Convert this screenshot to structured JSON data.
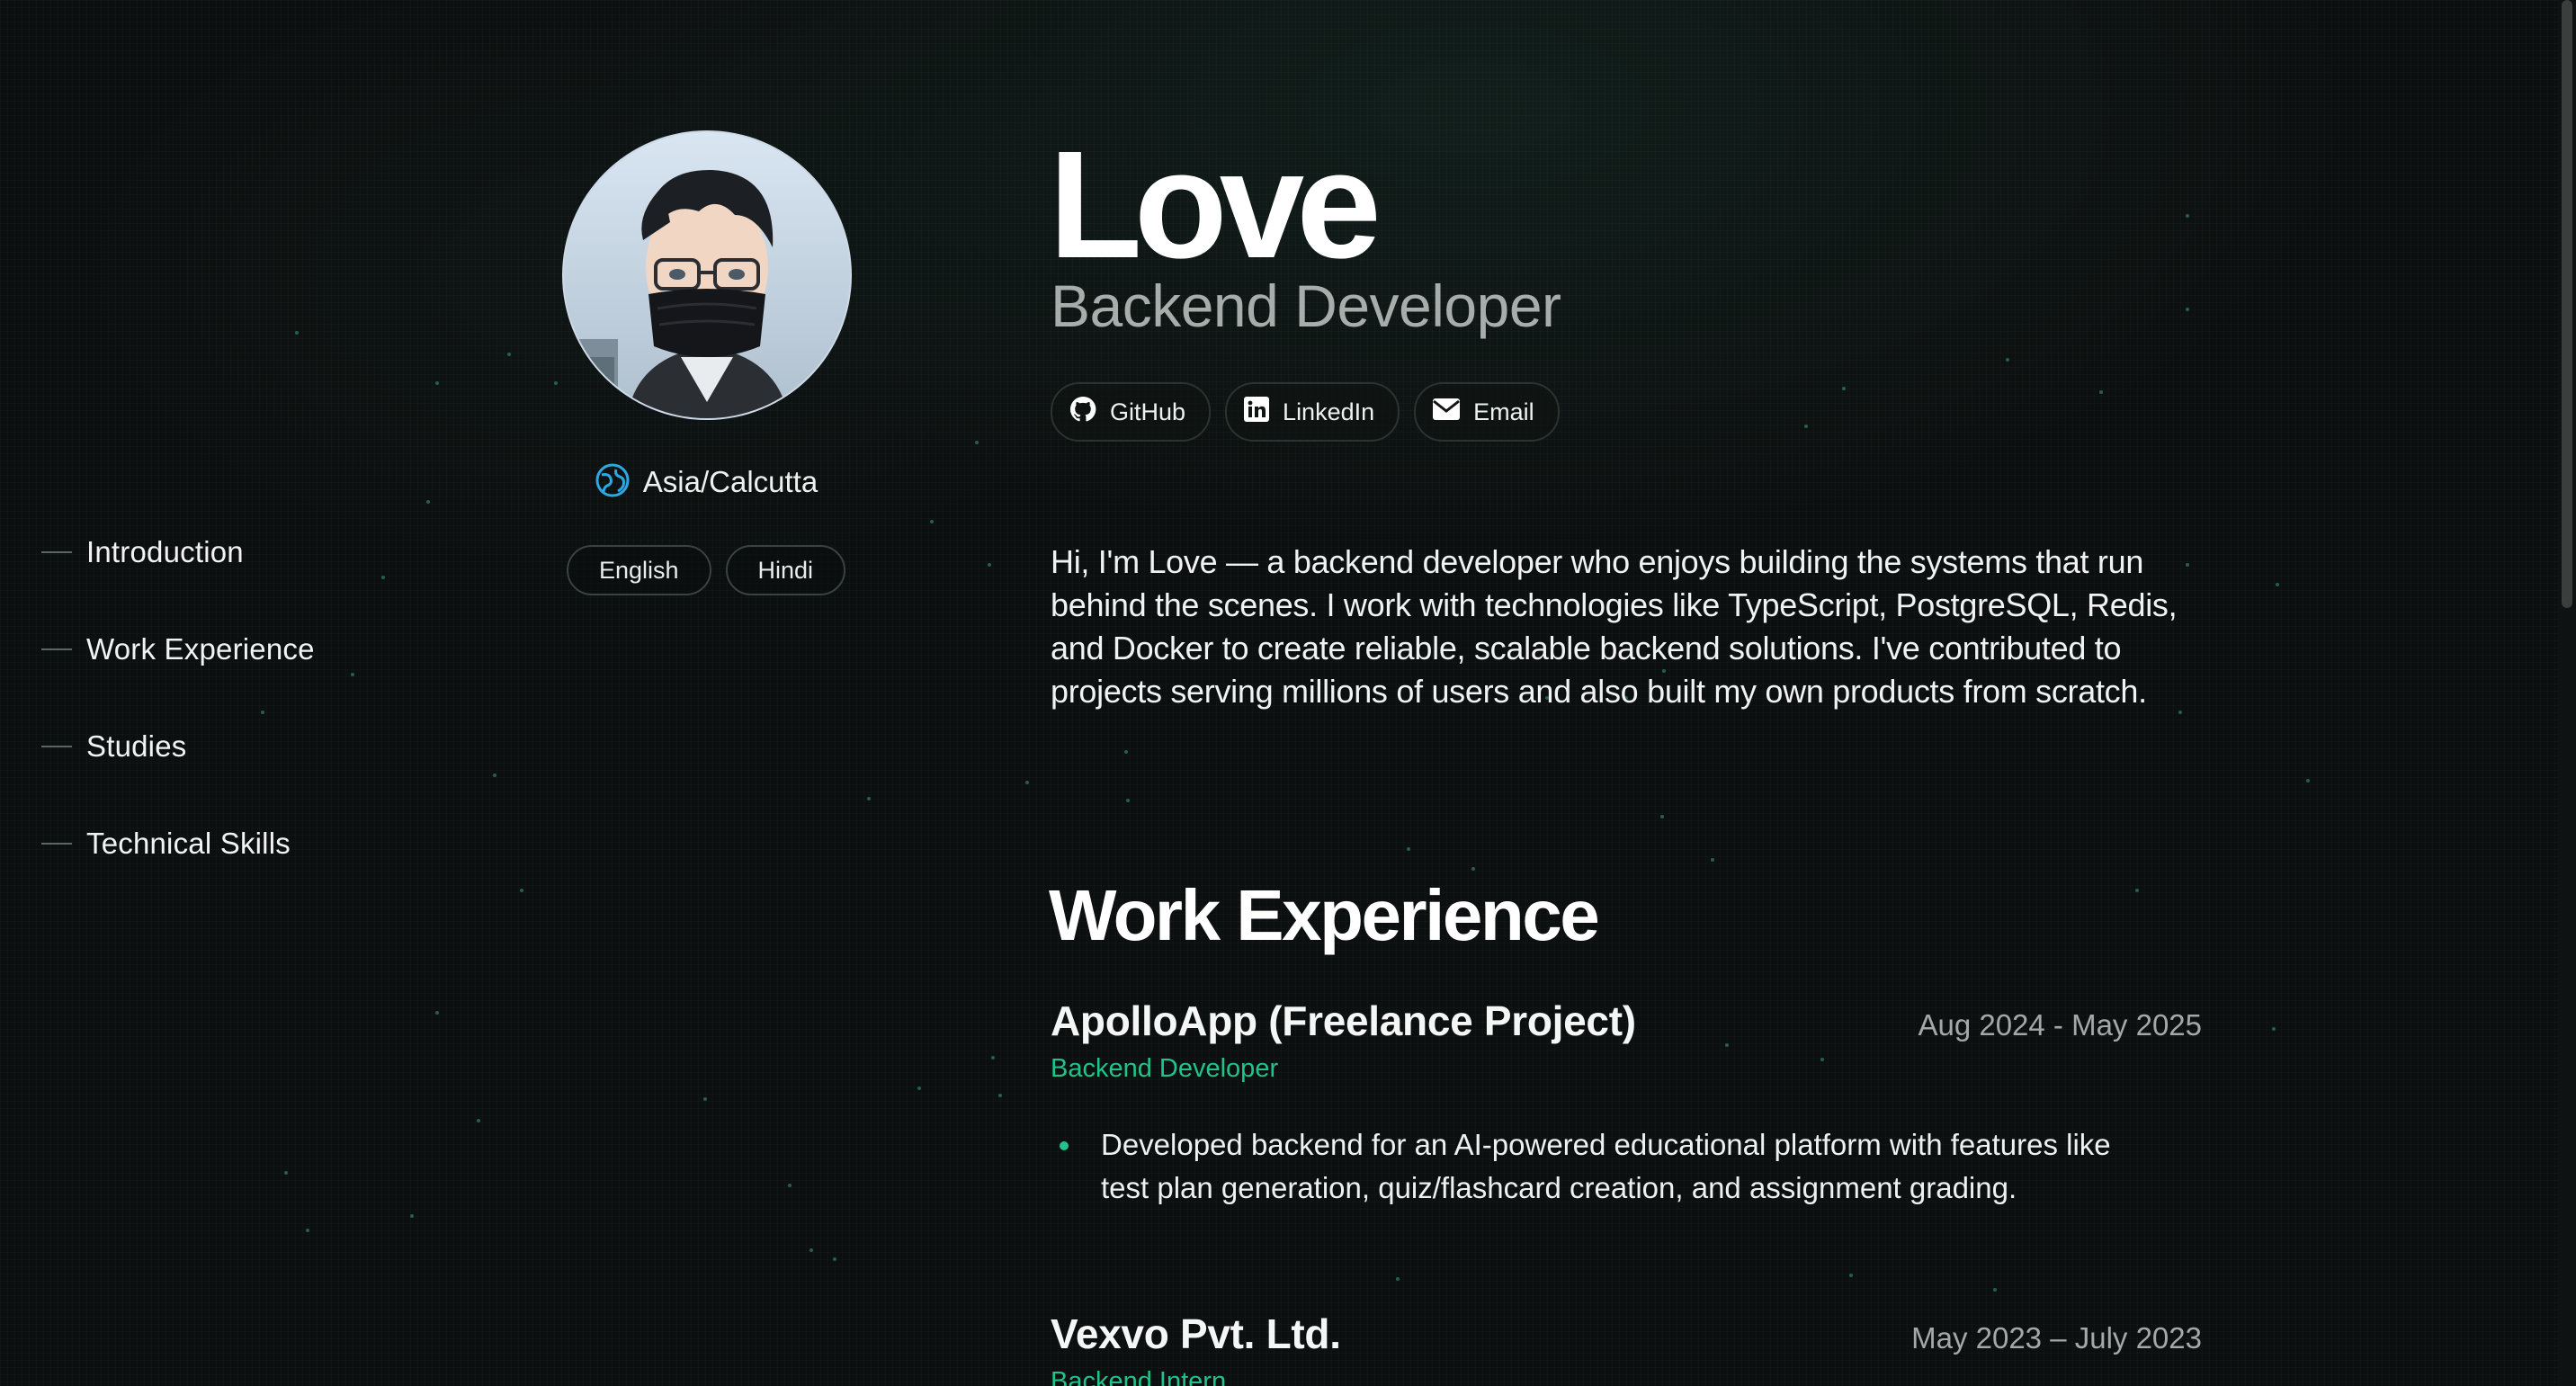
{
  "nav": {
    "items": [
      {
        "label": "Introduction"
      },
      {
        "label": "Work Experience"
      },
      {
        "label": "Studies"
      },
      {
        "label": "Technical Skills"
      }
    ]
  },
  "profile": {
    "avatar_icon": "avatar-portrait",
    "timezone": "Asia/Calcutta",
    "timezone_icon": "globe-icon",
    "languages": [
      "English",
      "Hindi"
    ]
  },
  "header": {
    "name": "Love",
    "role": "Backend Developer",
    "links": [
      {
        "label": "GitHub",
        "icon": "github-icon"
      },
      {
        "label": "LinkedIn",
        "icon": "linkedin-icon"
      },
      {
        "label": "Email",
        "icon": "email-icon"
      }
    ]
  },
  "intro": {
    "text": "Hi, I'm Love — a backend developer who enjoys building the systems that run behind the scenes. I work with technologies like TypeScript, PostgreSQL, Redis, and Docker to create reliable, scalable backend solutions. I've contributed to projects serving millions of users and also built my own products from scratch."
  },
  "work": {
    "title": "Work Experience",
    "jobs": [
      {
        "company": "ApolloApp (Freelance Project)",
        "dates": "Aug 2024 - May 2025",
        "role": "Backend Developer",
        "bullets": [
          "Developed backend for an AI-powered educational platform with features like test plan generation, quiz/flashcard creation, and assignment grading."
        ]
      },
      {
        "company": "Vexvo Pvt. Ltd.",
        "dates": "May 2023 – July 2023",
        "role": "Backend Intern",
        "bullets": []
      }
    ]
  },
  "theme": {
    "accent": "#22c38a",
    "background": "#0c0f0f",
    "muted_text": "#a7adab"
  }
}
